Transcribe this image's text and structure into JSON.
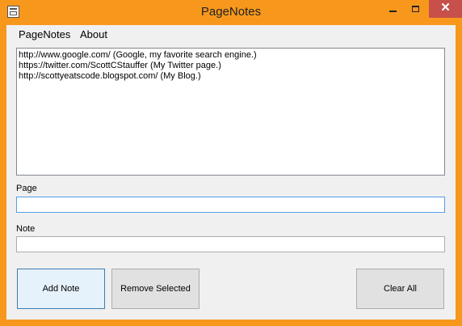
{
  "window": {
    "title": "PageNotes",
    "close_glyph": "✕"
  },
  "menu": {
    "items": [
      "PageNotes",
      "About"
    ]
  },
  "notes": [
    "http://www.google.com/ (Google, my favorite search engine.)",
    "https://twitter.com/ScottCStauffer (My Twitter page.)",
    "http://scottyeatscode.blogspot.com/ (My Blog.)"
  ],
  "page_field": {
    "label": "Page",
    "value": ""
  },
  "note_field": {
    "label": "Note",
    "value": ""
  },
  "buttons": {
    "add": "Add Note",
    "remove": "Remove Selected",
    "clear": "Clear All"
  },
  "colors": {
    "frame": "#f7981d",
    "close": "#c7504b",
    "focus": "#569de5"
  }
}
